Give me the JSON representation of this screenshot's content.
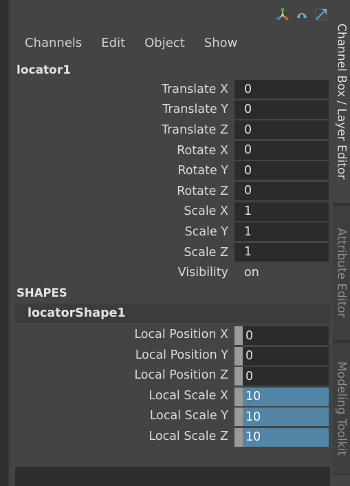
{
  "menubar": {
    "items": [
      "Channels",
      "Edit",
      "Object",
      "Show"
    ]
  },
  "toolbar_icons": [
    "channel-control-icon",
    "key-selected-icon",
    "graph-editor-icon"
  ],
  "node": {
    "title": "locator1",
    "attributes": [
      {
        "label": "Translate X",
        "value": "0"
      },
      {
        "label": "Translate Y",
        "value": "0"
      },
      {
        "label": "Translate Z",
        "value": "0"
      },
      {
        "label": "Rotate X",
        "value": "0"
      },
      {
        "label": "Rotate Y",
        "value": "0"
      },
      {
        "label": "Rotate Z",
        "value": "0"
      },
      {
        "label": "Scale X",
        "value": "1"
      },
      {
        "label": "Scale Y",
        "value": "1"
      },
      {
        "label": "Scale Z",
        "value": "1"
      },
      {
        "label": "Visibility",
        "value": "on"
      }
    ]
  },
  "shapes": {
    "header": "SHAPES",
    "node_name": "locatorShape1",
    "attributes": [
      {
        "label": "Local Position X",
        "value": "0",
        "highlighted": false
      },
      {
        "label": "Local Position Y",
        "value": "0",
        "highlighted": false
      },
      {
        "label": "Local Position Z",
        "value": "0",
        "highlighted": false
      },
      {
        "label": "Local Scale X",
        "value": "10",
        "highlighted": true
      },
      {
        "label": "Local Scale Y",
        "value": "10",
        "highlighted": true
      },
      {
        "label": "Local Scale Z",
        "value": "10",
        "highlighted": true
      }
    ]
  },
  "side_tabs": [
    {
      "label": "Channel Box / Layer Editor",
      "active": true
    },
    {
      "label": "Attribute Editor",
      "active": false
    },
    {
      "label": "Modeling Toolkit",
      "active": false
    }
  ],
  "colors": {
    "background": "#444444",
    "field": "#2b2b2b",
    "highlight": "#5285a6"
  }
}
